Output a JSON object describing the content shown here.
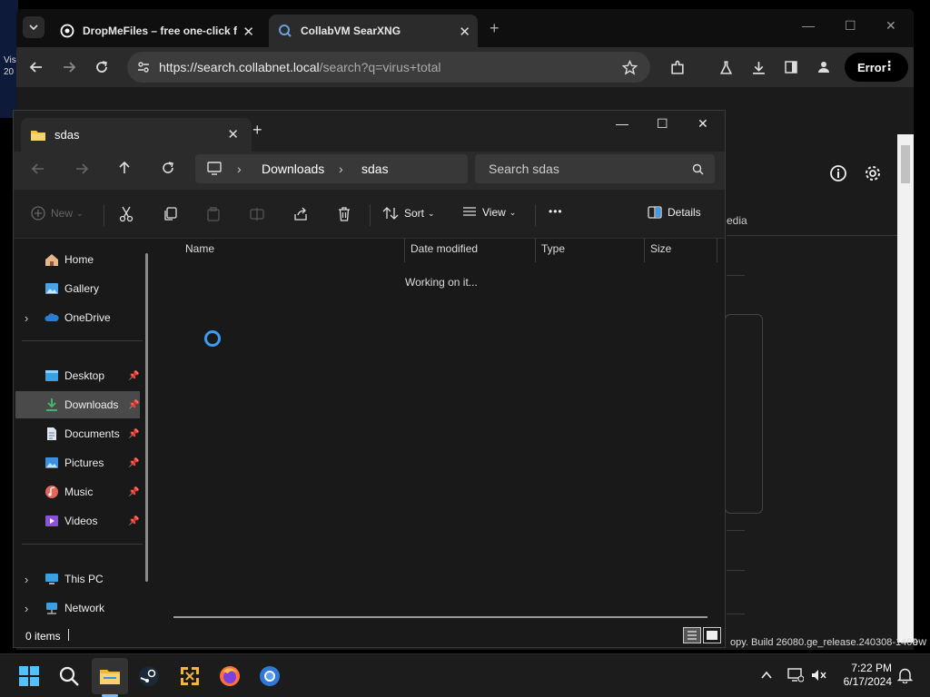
{
  "desktop": {
    "side_text_1": "Vis",
    "side_text_2": "20",
    "bottom_text": "ew"
  },
  "browser": {
    "tabs": [
      {
        "title": "DropMeFiles – free one-click fi",
        "close": "✕"
      },
      {
        "title": "CollabVM SearXNG",
        "close": "✕"
      }
    ],
    "new_tab": "+",
    "window_controls": {
      "minimize": "—",
      "maximize": "☐",
      "close": "✕"
    },
    "url_host": "https://search.collabnet.local",
    "url_path": "/search?q=virus+total",
    "profile_button": "Error",
    "profile_menu": "⋮",
    "page": {
      "media_text": "edia",
      "build_text": "opy. Build 26080.ge_release.240308-1400"
    }
  },
  "explorer": {
    "tab_title": "sdas",
    "tab_close": "✕",
    "new_tab": "+",
    "window_controls": {
      "minimize": "—",
      "maximize": "☐",
      "close": "✕"
    },
    "breadcrumb": [
      "Downloads",
      "sdas"
    ],
    "search_placeholder": "Search sdas",
    "commands": {
      "new": "New",
      "sort": "Sort",
      "view": "View",
      "more": "•••",
      "details": "Details"
    },
    "nav_items": [
      {
        "label": "Home",
        "icon": "home-icon",
        "pinned": false,
        "expandable": false
      },
      {
        "label": "Gallery",
        "icon": "gallery-icon",
        "pinned": false,
        "expandable": false
      },
      {
        "label": "OneDrive",
        "icon": "onedrive-icon",
        "pinned": false,
        "expandable": true
      },
      {
        "label": "Desktop",
        "icon": "desktop-folder-icon",
        "pinned": true,
        "expandable": false
      },
      {
        "label": "Downloads",
        "icon": "downloads-folder-icon",
        "pinned": true,
        "expandable": false,
        "selected": true
      },
      {
        "label": "Documents",
        "icon": "documents-folder-icon",
        "pinned": true,
        "expandable": false
      },
      {
        "label": "Pictures",
        "icon": "pictures-folder-icon",
        "pinned": true,
        "expandable": false
      },
      {
        "label": "Music",
        "icon": "music-folder-icon",
        "pinned": true,
        "expandable": false
      },
      {
        "label": "Videos",
        "icon": "videos-folder-icon",
        "pinned": true,
        "expandable": false
      },
      {
        "label": "This PC",
        "icon": "this-pc-icon",
        "pinned": false,
        "expandable": true
      },
      {
        "label": "Network",
        "icon": "network-icon",
        "pinned": false,
        "expandable": true
      }
    ],
    "columns": [
      "Name",
      "Date modified",
      "Type",
      "Size"
    ],
    "status_message": "Working on it...",
    "item_count": "0 items"
  },
  "taskbar": {
    "time": "7:22 PM",
    "date": "6/17/2024"
  },
  "colors": {
    "accent": "#3d9cf0",
    "folder": "#f2c14e"
  }
}
